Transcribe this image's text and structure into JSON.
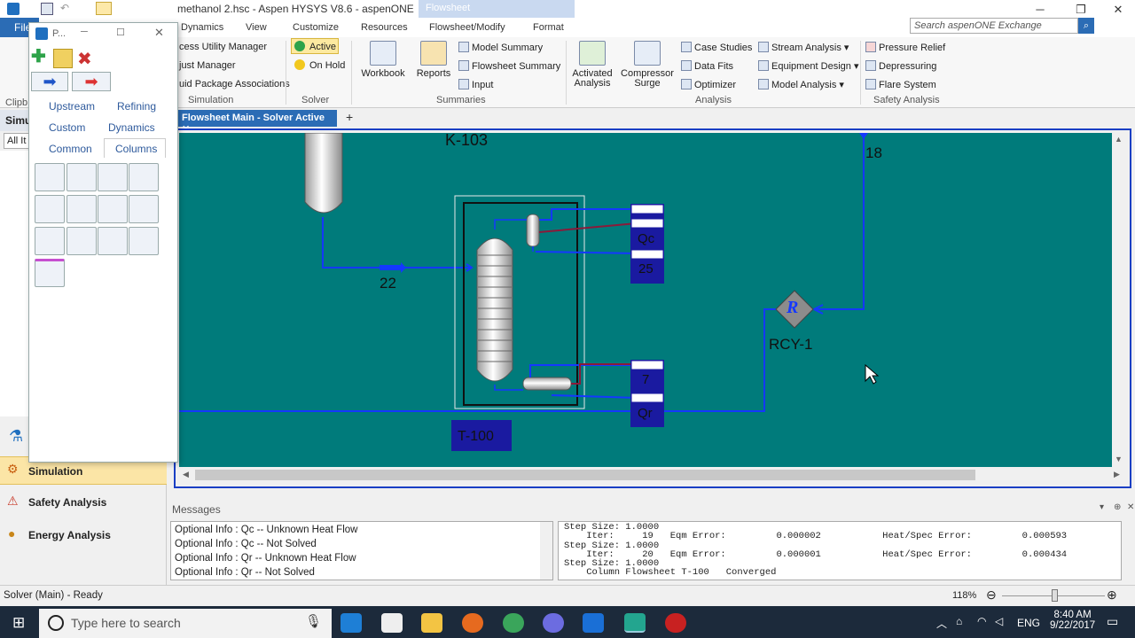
{
  "window": {
    "title": "methanol 2.hsc - Aspen HYSYS V8.6 - aspenONE",
    "context_tab": "Flowsheet"
  },
  "ribbon_tabs": [
    "File",
    "Dynamics",
    "View",
    "Customize",
    "Resources",
    "Flowsheet/Modify",
    "Format"
  ],
  "search": {
    "placeholder": "Search aspenONE Exchange"
  },
  "ribbon": {
    "simulation_items": [
      "cess Utility Manager",
      "just Manager",
      "uid Package Associations"
    ],
    "simulation_group": "Simulation",
    "solver_active": "Active",
    "solver_onhold": "On Hold",
    "solver_group": "Solver",
    "workbook": "Workbook",
    "reports": "Reports",
    "summaries_items": [
      "Model Summary",
      "Flowsheet Summary",
      "Input"
    ],
    "summaries_group": "Summaries",
    "activated_analysis": [
      "Activated",
      "Analysis"
    ],
    "compressor_surge": [
      "Compressor",
      "Surge"
    ],
    "analysis_items": [
      "Case Studies",
      "Data Fits",
      "Optimizer"
    ],
    "analysis_items2": [
      "Stream Analysis",
      "Equipment Design",
      "Model Analysis"
    ],
    "analysis_group": "Analysis",
    "safety_items": [
      "Pressure Relief",
      "Depressuring",
      "Flare System"
    ],
    "safety_group": "Safety Analysis"
  },
  "leftnav": {
    "partial_labels": [
      "Clipb",
      "Simu",
      "All It"
    ],
    "items": [
      "Simulation",
      "Safety Analysis",
      "Energy Analysis"
    ]
  },
  "palette": {
    "title": "P...",
    "categories": [
      "Upstream",
      "Refining",
      "Custom",
      "Dynamics",
      "Common",
      "Columns"
    ]
  },
  "flowsheet": {
    "tab": "Flowsheet Main - Solver Active",
    "labels": {
      "k103": "K-103",
      "s22": "22",
      "s18": "18",
      "rcy": "RCY-1",
      "rcy_glyph": "R",
      "t100": "T-100",
      "qc": "Qc",
      "s25": "25",
      "s7": "7",
      "qr": "Qr"
    }
  },
  "messages": {
    "title": "Messages",
    "left": [
      "Optional Info : Qc -- Unknown Heat Flow",
      "Optional Info : Qc -- Not Solved",
      "Optional Info : Qr -- Unknown Heat Flow",
      "Optional Info : Qr -- Not Solved"
    ],
    "right": "Step Size: 1.0000\n    Iter:     19   Eqm Error:         0.000002           Heat/Spec Error:         0.000593\nStep Size: 1.0000\n    Iter:     20   Eqm Error:         0.000001           Heat/Spec Error:         0.000434\nStep Size: 1.0000\n    Column Flowsheet T-100   Converged"
  },
  "status": {
    "text": "Solver (Main) - Ready",
    "zoom": "118%"
  },
  "taskbar": {
    "search": "Type here to search",
    "lang": "ENG",
    "time": "8:40 AM",
    "date": "9/22/2017"
  }
}
